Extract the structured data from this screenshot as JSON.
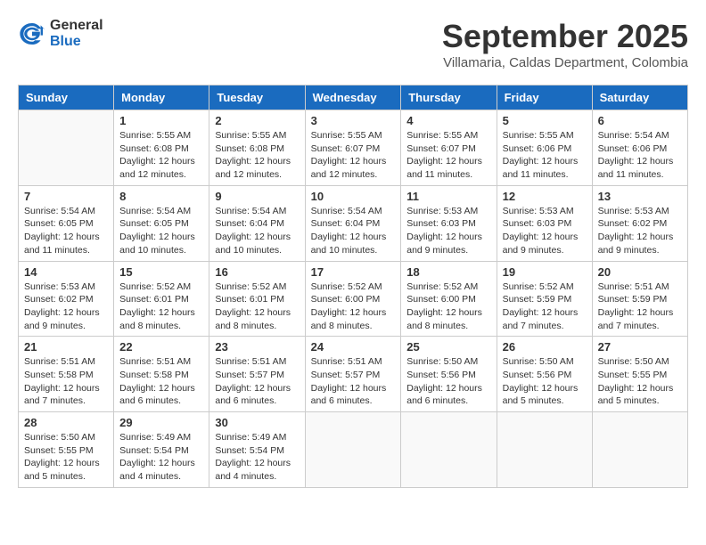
{
  "header": {
    "logo_general": "General",
    "logo_blue": "Blue",
    "month_year": "September 2025",
    "location": "Villamaria, Caldas Department, Colombia"
  },
  "days_of_week": [
    "Sunday",
    "Monday",
    "Tuesday",
    "Wednesday",
    "Thursday",
    "Friday",
    "Saturday"
  ],
  "weeks": [
    [
      {
        "day": "",
        "sunrise": "",
        "sunset": "",
        "daylight": ""
      },
      {
        "day": "1",
        "sunrise": "Sunrise: 5:55 AM",
        "sunset": "Sunset: 6:08 PM",
        "daylight": "Daylight: 12 hours and 12 minutes."
      },
      {
        "day": "2",
        "sunrise": "Sunrise: 5:55 AM",
        "sunset": "Sunset: 6:08 PM",
        "daylight": "Daylight: 12 hours and 12 minutes."
      },
      {
        "day": "3",
        "sunrise": "Sunrise: 5:55 AM",
        "sunset": "Sunset: 6:07 PM",
        "daylight": "Daylight: 12 hours and 12 minutes."
      },
      {
        "day": "4",
        "sunrise": "Sunrise: 5:55 AM",
        "sunset": "Sunset: 6:07 PM",
        "daylight": "Daylight: 12 hours and 11 minutes."
      },
      {
        "day": "5",
        "sunrise": "Sunrise: 5:55 AM",
        "sunset": "Sunset: 6:06 PM",
        "daylight": "Daylight: 12 hours and 11 minutes."
      },
      {
        "day": "6",
        "sunrise": "Sunrise: 5:54 AM",
        "sunset": "Sunset: 6:06 PM",
        "daylight": "Daylight: 12 hours and 11 minutes."
      }
    ],
    [
      {
        "day": "7",
        "sunrise": "Sunrise: 5:54 AM",
        "sunset": "Sunset: 6:05 PM",
        "daylight": "Daylight: 12 hours and 11 minutes."
      },
      {
        "day": "8",
        "sunrise": "Sunrise: 5:54 AM",
        "sunset": "Sunset: 6:05 PM",
        "daylight": "Daylight: 12 hours and 10 minutes."
      },
      {
        "day": "9",
        "sunrise": "Sunrise: 5:54 AM",
        "sunset": "Sunset: 6:04 PM",
        "daylight": "Daylight: 12 hours and 10 minutes."
      },
      {
        "day": "10",
        "sunrise": "Sunrise: 5:54 AM",
        "sunset": "Sunset: 6:04 PM",
        "daylight": "Daylight: 12 hours and 10 minutes."
      },
      {
        "day": "11",
        "sunrise": "Sunrise: 5:53 AM",
        "sunset": "Sunset: 6:03 PM",
        "daylight": "Daylight: 12 hours and 9 minutes."
      },
      {
        "day": "12",
        "sunrise": "Sunrise: 5:53 AM",
        "sunset": "Sunset: 6:03 PM",
        "daylight": "Daylight: 12 hours and 9 minutes."
      },
      {
        "day": "13",
        "sunrise": "Sunrise: 5:53 AM",
        "sunset": "Sunset: 6:02 PM",
        "daylight": "Daylight: 12 hours and 9 minutes."
      }
    ],
    [
      {
        "day": "14",
        "sunrise": "Sunrise: 5:53 AM",
        "sunset": "Sunset: 6:02 PM",
        "daylight": "Daylight: 12 hours and 9 minutes."
      },
      {
        "day": "15",
        "sunrise": "Sunrise: 5:52 AM",
        "sunset": "Sunset: 6:01 PM",
        "daylight": "Daylight: 12 hours and 8 minutes."
      },
      {
        "day": "16",
        "sunrise": "Sunrise: 5:52 AM",
        "sunset": "Sunset: 6:01 PM",
        "daylight": "Daylight: 12 hours and 8 minutes."
      },
      {
        "day": "17",
        "sunrise": "Sunrise: 5:52 AM",
        "sunset": "Sunset: 6:00 PM",
        "daylight": "Daylight: 12 hours and 8 minutes."
      },
      {
        "day": "18",
        "sunrise": "Sunrise: 5:52 AM",
        "sunset": "Sunset: 6:00 PM",
        "daylight": "Daylight: 12 hours and 8 minutes."
      },
      {
        "day": "19",
        "sunrise": "Sunrise: 5:52 AM",
        "sunset": "Sunset: 5:59 PM",
        "daylight": "Daylight: 12 hours and 7 minutes."
      },
      {
        "day": "20",
        "sunrise": "Sunrise: 5:51 AM",
        "sunset": "Sunset: 5:59 PM",
        "daylight": "Daylight: 12 hours and 7 minutes."
      }
    ],
    [
      {
        "day": "21",
        "sunrise": "Sunrise: 5:51 AM",
        "sunset": "Sunset: 5:58 PM",
        "daylight": "Daylight: 12 hours and 7 minutes."
      },
      {
        "day": "22",
        "sunrise": "Sunrise: 5:51 AM",
        "sunset": "Sunset: 5:58 PM",
        "daylight": "Daylight: 12 hours and 6 minutes."
      },
      {
        "day": "23",
        "sunrise": "Sunrise: 5:51 AM",
        "sunset": "Sunset: 5:57 PM",
        "daylight": "Daylight: 12 hours and 6 minutes."
      },
      {
        "day": "24",
        "sunrise": "Sunrise: 5:51 AM",
        "sunset": "Sunset: 5:57 PM",
        "daylight": "Daylight: 12 hours and 6 minutes."
      },
      {
        "day": "25",
        "sunrise": "Sunrise: 5:50 AM",
        "sunset": "Sunset: 5:56 PM",
        "daylight": "Daylight: 12 hours and 6 minutes."
      },
      {
        "day": "26",
        "sunrise": "Sunrise: 5:50 AM",
        "sunset": "Sunset: 5:56 PM",
        "daylight": "Daylight: 12 hours and 5 minutes."
      },
      {
        "day": "27",
        "sunrise": "Sunrise: 5:50 AM",
        "sunset": "Sunset: 5:55 PM",
        "daylight": "Daylight: 12 hours and 5 minutes."
      }
    ],
    [
      {
        "day": "28",
        "sunrise": "Sunrise: 5:50 AM",
        "sunset": "Sunset: 5:55 PM",
        "daylight": "Daylight: 12 hours and 5 minutes."
      },
      {
        "day": "29",
        "sunrise": "Sunrise: 5:49 AM",
        "sunset": "Sunset: 5:54 PM",
        "daylight": "Daylight: 12 hours and 4 minutes."
      },
      {
        "day": "30",
        "sunrise": "Sunrise: 5:49 AM",
        "sunset": "Sunset: 5:54 PM",
        "daylight": "Daylight: 12 hours and 4 minutes."
      },
      {
        "day": "",
        "sunrise": "",
        "sunset": "",
        "daylight": ""
      },
      {
        "day": "",
        "sunrise": "",
        "sunset": "",
        "daylight": ""
      },
      {
        "day": "",
        "sunrise": "",
        "sunset": "",
        "daylight": ""
      },
      {
        "day": "",
        "sunrise": "",
        "sunset": "",
        "daylight": ""
      }
    ]
  ]
}
